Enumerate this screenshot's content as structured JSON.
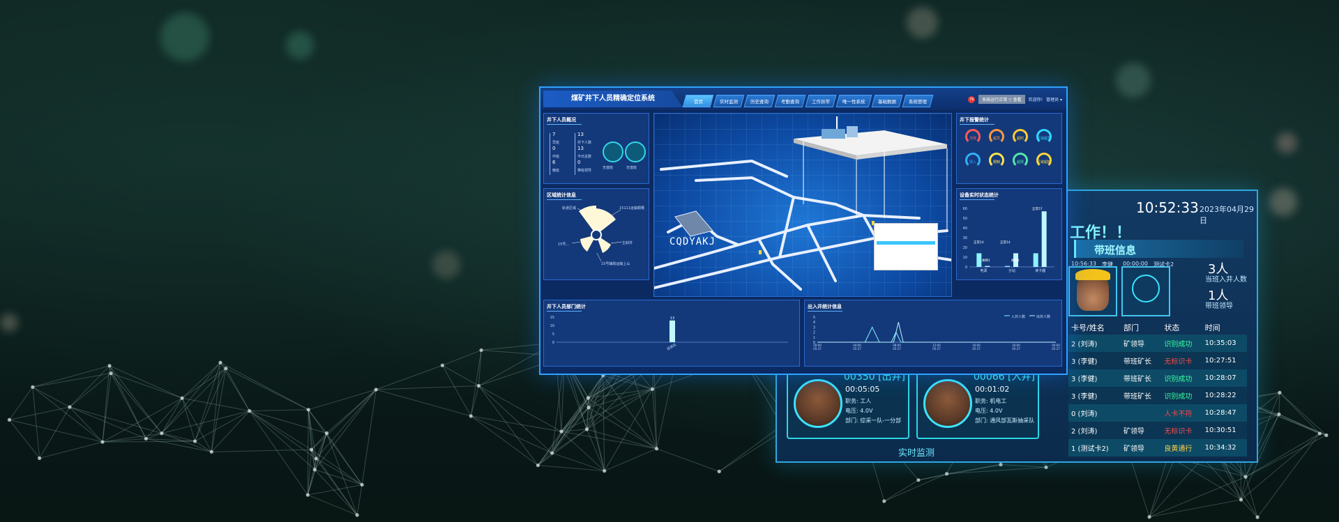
{
  "front": {
    "title": "煤矿井下人员精确定位系统",
    "tabs": [
      "首页",
      "实时监测",
      "历史查询",
      "考勤查询",
      "工作异常",
      "唯一性系统",
      "基础数据",
      "系统管理"
    ],
    "top_right": {
      "badge": "76",
      "alarm_btn": "系统运行正常 ▽ 查看",
      "user": "欢迎你!",
      "admin": "管理员 ▾"
    },
    "underground": {
      "title": "井下人员概况",
      "stats": [
        {
          "value": "7",
          "label": "早班"
        },
        {
          "value": "13",
          "label": "井下人数"
        },
        {
          "value": "0",
          "label": "中班"
        },
        {
          "value": "13",
          "label": "今日总数"
        },
        {
          "value": "6",
          "label": "晚班"
        },
        {
          "value": "0",
          "label": "带班领导"
        }
      ],
      "circle_labels": [
        "无值班",
        "无值班"
      ]
    },
    "region": {
      "title": "区域统计信息",
      "labels": [
        "轨道区域",
        "15111运输顺槽",
        "15号...",
        "主斜井",
        "15号辅助运输上山"
      ]
    },
    "watermark": "CQDYAKJ",
    "alarm": {
      "title": "井下报警统计",
      "gauges": [
        {
          "label": "求救",
          "color": "#ff5a5a"
        },
        {
          "label": "超员",
          "color": "#ff9a3a"
        },
        {
          "label": "超时",
          "color": "#ffcc33"
        },
        {
          "label": "区域超员",
          "color": "#33d7ff"
        },
        {
          "label": "限入",
          "color": "#33b0ff"
        },
        {
          "label": "限制",
          "color": "#ffe34d"
        },
        {
          "label": "超限",
          "color": "#54e8a8"
        },
        {
          "label": "区域超时",
          "color": "#ffd93a"
        }
      ]
    },
    "device": {
      "title": "设备实时状态统计",
      "chart_data": {
        "type": "bar",
        "categories": [
          "电源",
          "分站",
          "读卡器"
        ],
        "series": [
          {
            "name": "",
            "values": [
              14,
              1,
              14
            ]
          },
          {
            "name": "",
            "values": [
              1,
              14,
              57
            ]
          }
        ],
        "data_labels": [
          "正常14",
          "故障1",
          "正常14",
          "故障1",
          "正常57"
        ],
        "yticks": [
          "60",
          "50",
          "40",
          "30",
          "20",
          "10",
          "0"
        ],
        "ylim": [
          0,
          60
        ]
      }
    },
    "dept": {
      "title": "井下人员部门统计",
      "chart_data": {
        "type": "bar",
        "categories": [
          "综采队"
        ],
        "values": [
          13
        ],
        "yticks": [
          "15",
          "10",
          "5",
          "0"
        ],
        "ylim": [
          0,
          15
        ]
      }
    },
    "inout": {
      "title": "出入井统计信息",
      "legend": [
        "入井人数",
        "出井人数"
      ],
      "chart_data": {
        "type": "line",
        "xticks": [
          "00:00 05-27",
          "04:00 05-27",
          "08:00 05-27",
          "12:00 05-27",
          "16:00 05-27",
          "20:00 05-27",
          "00:00 05-27"
        ],
        "yticks": [
          "5",
          "4",
          "3",
          "2",
          "1",
          "0"
        ],
        "ylim": [
          0,
          5
        ],
        "series": [
          {
            "name": "入井人数",
            "points": [
              [
                0,
                0
              ],
              [
                0.2,
                0
              ],
              [
                0.23,
                3
              ],
              [
                0.26,
                0
              ],
              [
                0.31,
                0
              ],
              [
                0.33,
                2
              ],
              [
                0.35,
                0
              ],
              [
                1,
                0
              ]
            ]
          },
          {
            "name": "出井人数",
            "points": [
              [
                0,
                0
              ],
              [
                0.32,
                0
              ],
              [
                0.34,
                4
              ],
              [
                0.36,
                0
              ],
              [
                1,
                0
              ]
            ]
          }
        ]
      }
    }
  },
  "back": {
    "clock": "10:52:33",
    "date": "2023年04月29日",
    "welcome": "工作！！",
    "duty_title": "带班信息",
    "duty_mini": [
      "10:56:33",
      "李健",
      "00:00:00",
      "测试卡2"
    ],
    "stats": [
      {
        "value": "3人",
        "label": "当班入井人数"
      },
      {
        "value": "1人",
        "label": "带班领导"
      }
    ],
    "table": {
      "headers": [
        "卡号/姓名",
        "部门",
        "状态",
        "时间"
      ],
      "rows": [
        [
          "2 (刘涛)",
          "矿领导",
          "识别成功",
          "10:35:03",
          "ok"
        ],
        [
          "3 (李健)",
          "带班矿长",
          "无标识卡",
          "10:27:51",
          "bad"
        ],
        [
          "3 (李健)",
          "带班矿长",
          "识别成功",
          "10:28:07",
          "ok"
        ],
        [
          "3 (李健)",
          "带班矿长",
          "识别成功",
          "10:28:22",
          "ok"
        ],
        [
          "0 (刘涛)",
          "",
          "人卡不符",
          "10:28:47",
          "bad"
        ],
        [
          "2 (刘涛)",
          "矿领导",
          "无标识卡",
          "10:30:51",
          "bad"
        ],
        [
          "1 (测试卡2)",
          "矿领导",
          "良黄通行",
          "10:34:32",
          "warn"
        ]
      ]
    },
    "workers": [
      {
        "id": "00350 [出井]",
        "time": "00:05:05",
        "job": "职务: 工人",
        "power": "电压: 4.0V",
        "dept": "部门: 综采一队-一分部"
      },
      {
        "id": "00066 [入井]",
        "time": "00:01:02",
        "job": "职务: 机电工",
        "power": "电压: 4.0V",
        "dept": "部门: 通风部瓦斯抽采队"
      }
    ],
    "footer": "实时监测"
  }
}
